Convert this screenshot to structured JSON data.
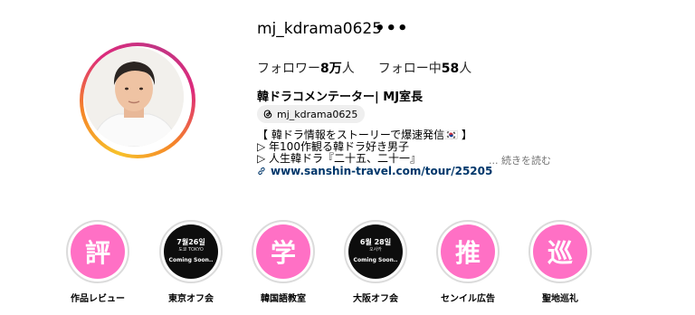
{
  "profile": {
    "username": "mj_kdrama0625",
    "more_icon": "•••",
    "stats": {
      "followers_label": "フォロワー",
      "followers_value": "8万",
      "followers_suffix": "人",
      "following_label": "フォロー中",
      "following_value": "58",
      "following_suffix": "人"
    },
    "full_name": "韓ドラコメンテーター| MJ室長",
    "threads_handle": "mj_kdrama0625",
    "bio_lines": [
      "【 韓ドラ情報をストーリーで爆速発信🇰🇷 】",
      "▷ 年100作観る韓ドラ好き男子",
      "▷ 人生韓ドラ『二十五、二十一』"
    ],
    "more_text": "... 続きを読む",
    "link_text": "www.sanshin-travel.com/tour/25205"
  },
  "highlights": [
    {
      "type": "pink",
      "glyph": "評",
      "label": "作品レビュー"
    },
    {
      "type": "dark",
      "date": "7월26일",
      "location": "도쿄 TOKYO",
      "note": "Coming Soon..",
      "label": "東京オフ会"
    },
    {
      "type": "pink",
      "glyph": "学",
      "label": "韓国語教室"
    },
    {
      "type": "dark",
      "date": "6월 28일",
      "location": "오사카",
      "note": "Coming Soon..",
      "label": "大阪オフ会"
    },
    {
      "type": "pink",
      "glyph": "推",
      "label": "センイル広告"
    },
    {
      "type": "pink",
      "glyph": "巡",
      "label": "聖地巡礼"
    }
  ],
  "colors": {
    "highlight_pink": "#ff70c5",
    "link_blue": "#00376b",
    "ring_gray": "#dbdbdb"
  }
}
